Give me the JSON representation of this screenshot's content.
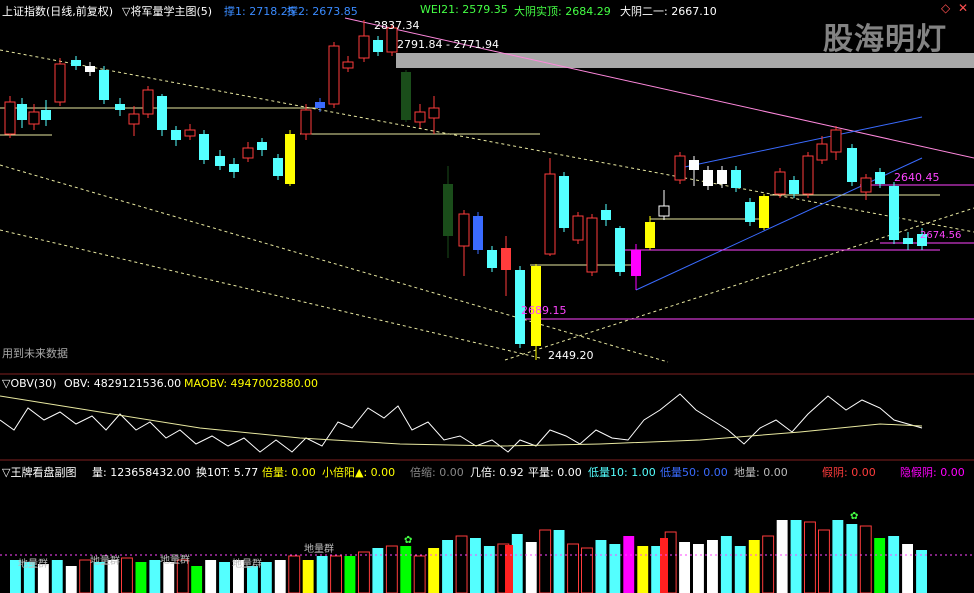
{
  "colors": {
    "bg": "#000000",
    "up": "#ff3c3c",
    "down": "#54ffff",
    "yellow": "#ffff00",
    "magenta": "#ff00ff",
    "green": "#00ff00",
    "white": "#ffffff",
    "pink": "#ff66cc",
    "blue": "#3a6bff",
    "divider": "#802020"
  },
  "main_panel": {
    "title": "上证指数(日线,前复权)",
    "indicator": "▽将军量学主图(5)",
    "items": [
      {
        "label": "撑1: 2718.25",
        "color": "#3a8bff"
      },
      {
        "label": "撑2: 2673.85",
        "color": "#3a8bff"
      },
      {
        "label": "WEI21: 2579.35",
        "color": "#44ff44"
      },
      {
        "label": "大阴实顶: 2684.29",
        "color": "#44ff44"
      },
      {
        "label": "大阴二一: 2667.10",
        "color": "#ffffff"
      }
    ],
    "annotations": {
      "high": "2837.34",
      "range": "2791.84 - 2771.94",
      "low": "2449.20",
      "level_a": "2689.15",
      "level_b": "2640.45",
      "level_c": "2674.56",
      "future": "用到未来数据"
    }
  },
  "watermark": "股海明灯",
  "window_buttons": {
    "settings": "◇",
    "close": "✕"
  },
  "obv_panel": {
    "title": "▽OBV(30)",
    "obv": "OBV: 4829121536.00",
    "maobv": "MAOBV: 4947002880.00"
  },
  "vol_panel": {
    "title": "▽王牌看盘副图",
    "items": [
      {
        "label": "量: 123658432.00",
        "color": "#ffffff"
      },
      {
        "label": "换10T: 5.77",
        "color": "#ffffff"
      },
      {
        "label": "倍量: 0.00",
        "color": "#ffff00"
      },
      {
        "label": "小倍阳▲: 0.00",
        "color": "#ffff00"
      },
      {
        "label": "倍缩: 0.00",
        "color": "#888888"
      },
      {
        "label": "几倍: 0.92",
        "color": "#ffffff"
      },
      {
        "label": "平量: 0.00",
        "color": "#ffffff"
      },
      {
        "label": "低量10: 1.00",
        "color": "#54ffff"
      },
      {
        "label": "低量50: 0.00",
        "color": "#3a6bff"
      },
      {
        "label": "地量: 0.00",
        "color": "#bbbbbb"
      },
      {
        "label": "假阴: 0.00",
        "color": "#ff3c3c"
      },
      {
        "label": "隐假阴: 0.00",
        "color": "#ff00ff"
      }
    ],
    "bar_tags": [
      "地量群",
      "地量群",
      "地量群",
      "地量群",
      "地量群"
    ],
    "marker": "✿"
  }
}
